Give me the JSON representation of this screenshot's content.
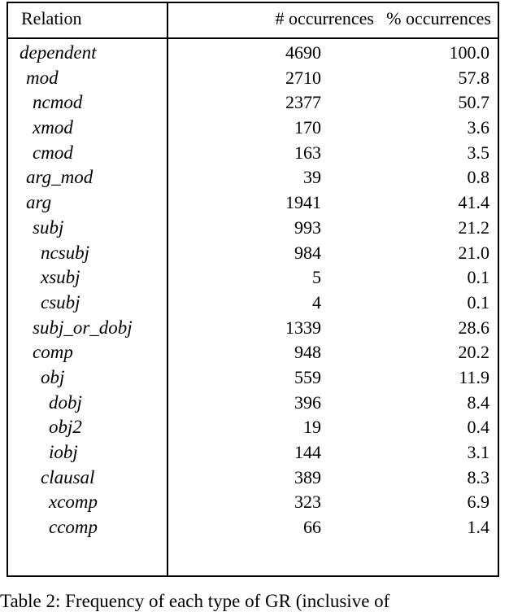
{
  "table": {
    "headers": {
      "relation": "Relation",
      "count": "# occurrences",
      "percent": "% occurrences"
    },
    "rows": [
      {
        "relation": "dependent",
        "depth": 0,
        "count": "4690",
        "percent": "100.0"
      },
      {
        "relation": "mod",
        "depth": 1,
        "count": "2710",
        "percent": "57.8"
      },
      {
        "relation": "ncmod",
        "depth": 2,
        "count": "2377",
        "percent": "50.7"
      },
      {
        "relation": "xmod",
        "depth": 2,
        "count": "170",
        "percent": "3.6"
      },
      {
        "relation": "cmod",
        "depth": 2,
        "count": "163",
        "percent": "3.5"
      },
      {
        "relation": "arg_mod",
        "depth": 1,
        "count": "39",
        "percent": "0.8"
      },
      {
        "relation": "arg",
        "depth": 1,
        "count": "1941",
        "percent": "41.4"
      },
      {
        "relation": "subj",
        "depth": 2,
        "count": "993",
        "percent": "21.2"
      },
      {
        "relation": "ncsubj",
        "depth": 3,
        "count": "984",
        "percent": "21.0"
      },
      {
        "relation": "xsubj",
        "depth": 3,
        "count": "5",
        "percent": "0.1"
      },
      {
        "relation": "csubj",
        "depth": 3,
        "count": "4",
        "percent": "0.1"
      },
      {
        "relation": "subj_or_dobj",
        "depth": 2,
        "count": "1339",
        "percent": "28.6"
      },
      {
        "relation": "comp",
        "depth": 2,
        "count": "948",
        "percent": "20.2"
      },
      {
        "relation": "obj",
        "depth": 3,
        "count": "559",
        "percent": "11.9"
      },
      {
        "relation": "dobj",
        "depth": 4,
        "count": "396",
        "percent": "8.4"
      },
      {
        "relation": "obj2",
        "depth": 4,
        "count": "19",
        "percent": "0.4"
      },
      {
        "relation": "iobj",
        "depth": 4,
        "count": "144",
        "percent": "3.1"
      },
      {
        "relation": "clausal",
        "depth": 3,
        "count": "389",
        "percent": "8.3"
      },
      {
        "relation": "xcomp",
        "depth": 4,
        "count": "323",
        "percent": "6.9"
      },
      {
        "relation": "ccomp",
        "depth": 4,
        "count": "66",
        "percent": "1.4"
      }
    ]
  },
  "caption": "Table 2: Frequency of each type of GR (inclusive of"
}
